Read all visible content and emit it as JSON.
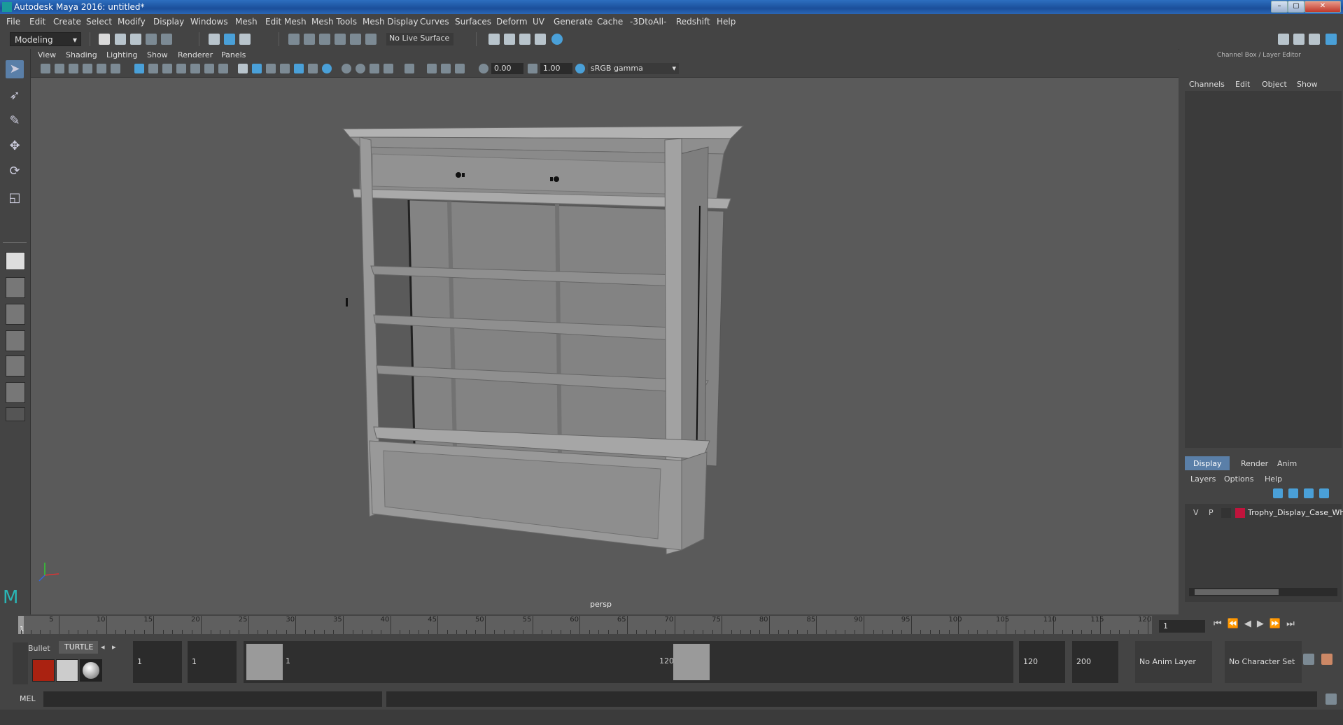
{
  "window": {
    "title": "Autodesk Maya 2016: untitled*"
  },
  "menubar": [
    "File",
    "Edit",
    "Create",
    "Select",
    "Modify",
    "Display",
    "Windows",
    "Mesh",
    "Edit Mesh",
    "Mesh Tools",
    "Mesh Display",
    "Curves",
    "Surfaces",
    "Deform",
    "UV",
    "Generate",
    "Cache",
    "-3DtoAll-",
    "Redshift",
    "Help"
  ],
  "statusline": {
    "mode": "Modeling",
    "live_surface": "No Live Surface"
  },
  "viewport": {
    "menu": [
      "View",
      "Shading",
      "Lighting",
      "Show",
      "Renderer",
      "Panels"
    ],
    "exposure": "0.00",
    "gamma": "1.00",
    "color_space": "sRGB gamma",
    "camera_label": "persp"
  },
  "channel_box": {
    "title": "Channel Box / Layer Editor",
    "menu": [
      "Channels",
      "Edit",
      "Object",
      "Show"
    ]
  },
  "layer_editor": {
    "tabs": [
      "Display",
      "Render",
      "Anim"
    ],
    "menu": [
      "Layers",
      "Options",
      "Help"
    ],
    "layer": {
      "visible": "V",
      "playback": "P",
      "name": "Trophy_Display_Case_Wh",
      "color": "#c0143c"
    }
  },
  "timeline": {
    "ticks": [
      "5",
      "10",
      "15",
      "20",
      "25",
      "30",
      "35",
      "40",
      "45",
      "50",
      "55",
      "60",
      "65",
      "70",
      "75",
      "80",
      "85",
      "90",
      "95",
      "100",
      "105",
      "110",
      "115",
      "120"
    ],
    "current_marker": "1",
    "current_frame": "1"
  },
  "range": {
    "shelf_tabs": [
      "Bullet",
      "TURTLE"
    ],
    "start": "1",
    "playback_start": "1",
    "slider_start": "1",
    "slider_end": "120",
    "playback_end": "120",
    "end": "200",
    "anim_layer": "No Anim Layer",
    "character_set": "No Character Set"
  },
  "cmdline": {
    "label": "MEL"
  }
}
